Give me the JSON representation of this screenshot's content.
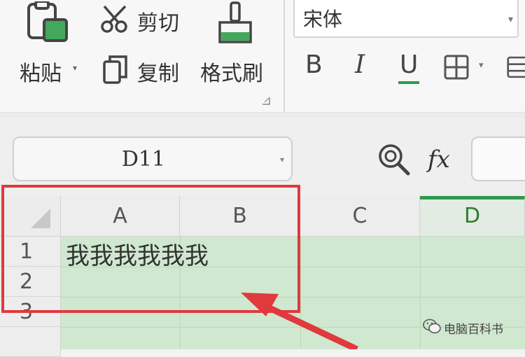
{
  "ribbon": {
    "paste_label": "粘贴",
    "cut_label": "剪切",
    "copy_label": "复制",
    "format_painter_label": "格式刷",
    "font_name": "宋体",
    "bold_label": "B",
    "italic_label": "I",
    "underline_label": "U"
  },
  "formula_bar": {
    "name_box_value": "D11",
    "fx_label": "fx"
  },
  "sheet": {
    "columns": [
      "A",
      "B",
      "C",
      "D"
    ],
    "rows": [
      "1",
      "2",
      "3"
    ],
    "cell_a1": "我我我我我我",
    "active_column": "D"
  },
  "watermark": {
    "text": "电脑百科书"
  },
  "colors": {
    "accent_green": "#2e9a4f",
    "annotation_red": "#e0393e",
    "selection_fill": "#cfe8cf"
  }
}
